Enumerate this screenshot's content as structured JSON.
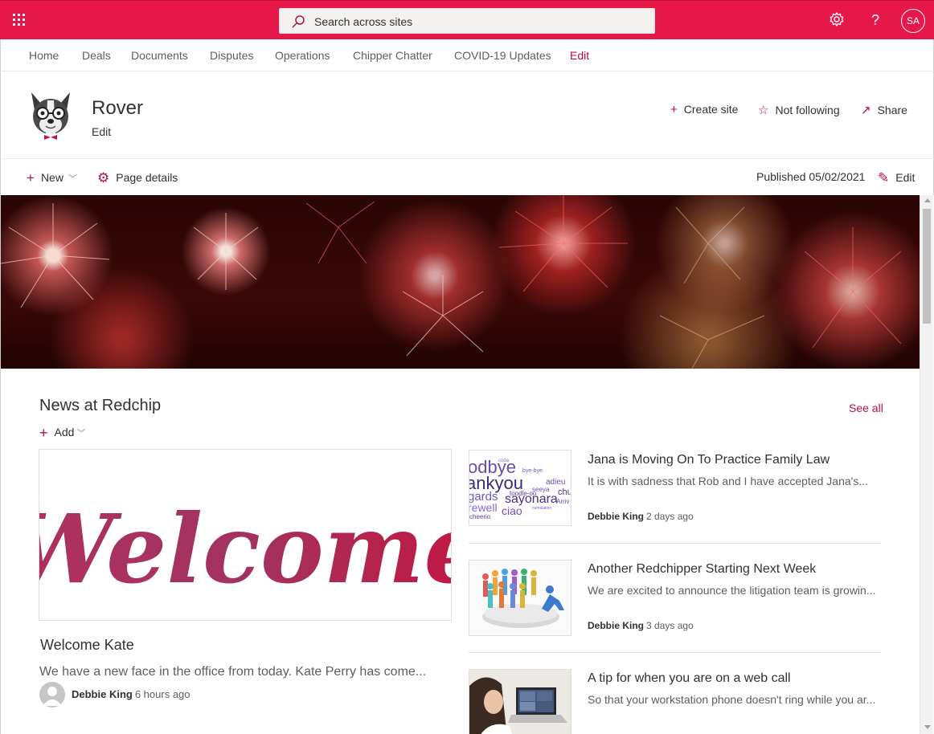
{
  "suite_bar": {
    "search_placeholder": "Search across sites",
    "help_label": "?",
    "user_initials": "SA",
    "accent_color": "#e8174a"
  },
  "top_nav": {
    "items": [
      "Home",
      "Deals",
      "Documents",
      "Disputes",
      "Operations",
      "Chipper Chatter",
      "COVID-19 Updates"
    ],
    "edit_label": "Edit"
  },
  "site_header": {
    "title": "Rover",
    "edit_label": "Edit",
    "actions": {
      "create_site": "Create site",
      "not_following": "Not following",
      "share": "Share"
    }
  },
  "command_bar": {
    "new_label": "New",
    "page_details_label": "Page details",
    "published": "Published 05/02/2021",
    "edit_label": "Edit"
  },
  "news": {
    "title": "News at Redchip",
    "see_all": "See all",
    "add_label": "Add",
    "hero": {
      "image_text": "Welcome",
      "title": "Welcome Kate",
      "description": "We have a new face in the office from today. Kate Perry has come...",
      "author": "Debbie King",
      "ago": "6 hours ago"
    },
    "items": [
      {
        "title": "Jana is Moving On To Practice Family Law",
        "description": "It is with sadness that Rob and I have accepted Jana's...",
        "author": "Debbie King",
        "ago": "2 days ago"
      },
      {
        "title": "Another Redchipper Starting Next Week",
        "description": "We are excited to announce the litigation team is growin...",
        "author": "Debbie King",
        "ago": "3 days ago"
      },
      {
        "title": "A tip for when you are on a web call",
        "description": "So that your workstation phone doesn't ring while you ar..."
      }
    ]
  },
  "thumb_words": [
    "odbye",
    "ankyou",
    "gards",
    "sayonara",
    "ciao",
    "adieu",
    "bye-bye",
    "seeya",
    "rewell",
    "cheerio",
    "toodle-oo",
    "coda",
    "chu",
    "Arriv",
    "cumulation"
  ]
}
